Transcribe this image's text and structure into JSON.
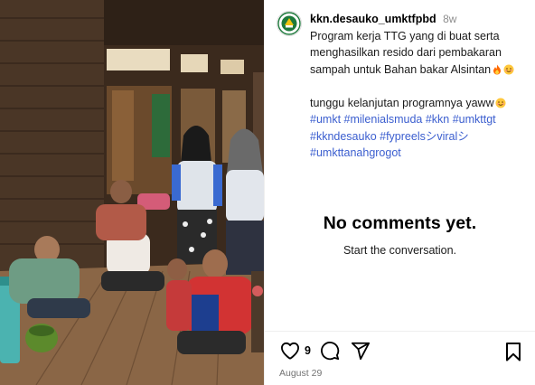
{
  "post": {
    "username": "kkn.desauko_umktfpbd",
    "time_ago": "8w",
    "caption_lines": [
      "Program kerja TTG yang di buat serta",
      "menghasilkan resido dari pembakaran",
      "sampah untuk Bahan bakar Alsintan"
    ],
    "caption_line2": "tunggu kelanjutan programnya yaww",
    "hashtags_lines": [
      "#umkt #milenialsmuda #kkn #umkttgt",
      "#kkndesauko #fypreelsシviralシ",
      "#umkttanahgrogot"
    ],
    "likes": "9",
    "date": "August 29"
  },
  "comments": {
    "empty_title": "No comments yet.",
    "empty_subtitle": "Start the conversation."
  },
  "icons": {
    "avatar": "umkt-logo-avatar",
    "like": "heart-icon",
    "comment": "comment-icon",
    "share": "share-icon",
    "save": "bookmark-icon"
  }
}
